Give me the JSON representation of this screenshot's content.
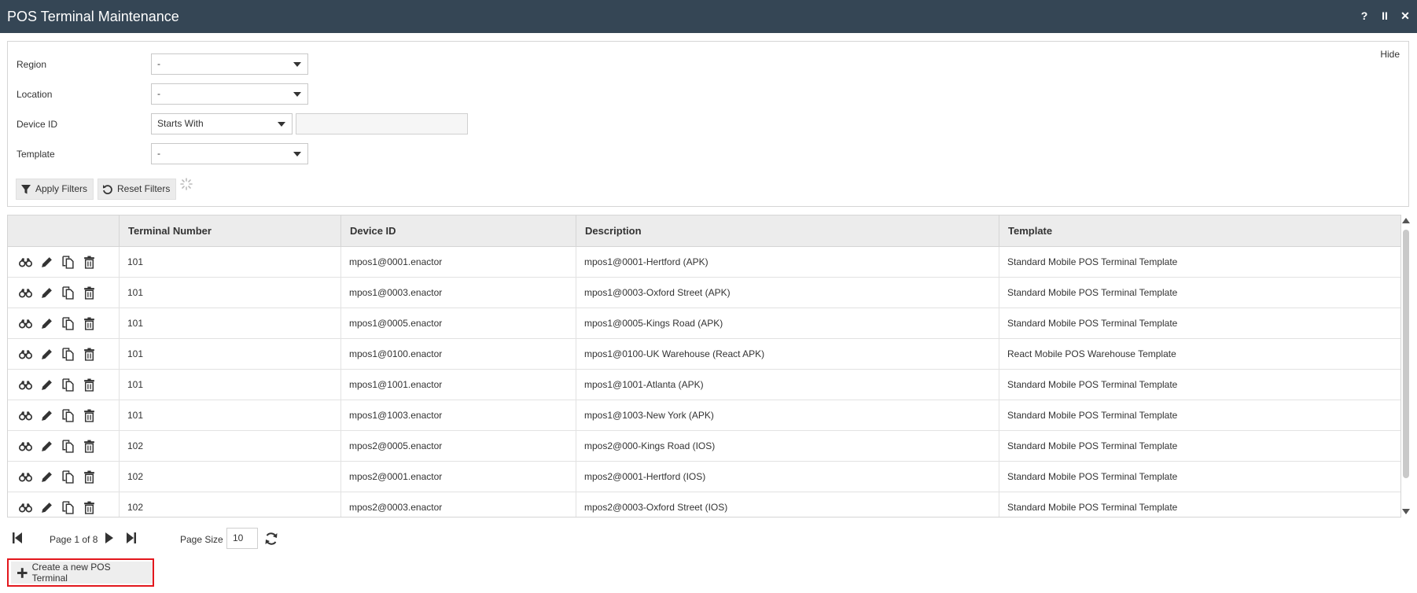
{
  "window": {
    "title": "POS Terminal Maintenance",
    "controls": [
      "?",
      "II",
      "✕"
    ]
  },
  "filters": {
    "hide_label": "Hide",
    "region": {
      "label": "Region",
      "value": "-"
    },
    "location": {
      "label": "Location",
      "value": "-"
    },
    "device_id": {
      "label": "Device ID",
      "match_mode": "Starts With",
      "value": ""
    },
    "template": {
      "label": "Template",
      "value": "-"
    },
    "apply_label": "Apply Filters",
    "reset_label": "Reset Filters"
  },
  "table": {
    "columns": [
      "Terminal Number",
      "Device ID",
      "Description",
      "Template"
    ],
    "rows": [
      {
        "terminal": "101",
        "device": "mpos1@0001.enactor",
        "description": "mpos1@0001-Hertford (APK)",
        "template": "Standard Mobile POS Terminal Template"
      },
      {
        "terminal": "101",
        "device": "mpos1@0003.enactor",
        "description": "mpos1@0003-Oxford Street (APK)",
        "template": "Standard Mobile POS Terminal Template"
      },
      {
        "terminal": "101",
        "device": "mpos1@0005.enactor",
        "description": "mpos1@0005-Kings Road (APK)",
        "template": "Standard Mobile POS Terminal Template"
      },
      {
        "terminal": "101",
        "device": "mpos1@0100.enactor",
        "description": "mpos1@0100-UK Warehouse (React APK)",
        "template": "React Mobile POS Warehouse Template"
      },
      {
        "terminal": "101",
        "device": "mpos1@1001.enactor",
        "description": "mpos1@1001-Atlanta (APK)",
        "template": "Standard Mobile POS Terminal Template"
      },
      {
        "terminal": "101",
        "device": "mpos1@1003.enactor",
        "description": "mpos1@1003-New York (APK)",
        "template": "Standard Mobile POS Terminal Template"
      },
      {
        "terminal": "102",
        "device": "mpos2@0005.enactor",
        "description": "mpos2@000-Kings Road (IOS)",
        "template": "Standard Mobile POS Terminal Template"
      },
      {
        "terminal": "102",
        "device": "mpos2@0001.enactor",
        "description": "mpos2@0001-Hertford (IOS)",
        "template": "Standard Mobile POS Terminal Template"
      },
      {
        "terminal": "102",
        "device": "mpos2@0003.enactor",
        "description": "mpos2@0003-Oxford Street (IOS)",
        "template": "Standard Mobile POS Terminal Template"
      }
    ]
  },
  "pager": {
    "page_text": "Page 1 of 8",
    "page_size_label": "Page Size",
    "page_size": "10"
  },
  "create_button": {
    "label": "Create a new POS Terminal"
  },
  "colors": {
    "titlebar": "#354655",
    "highlight_border": "#e3171d"
  }
}
